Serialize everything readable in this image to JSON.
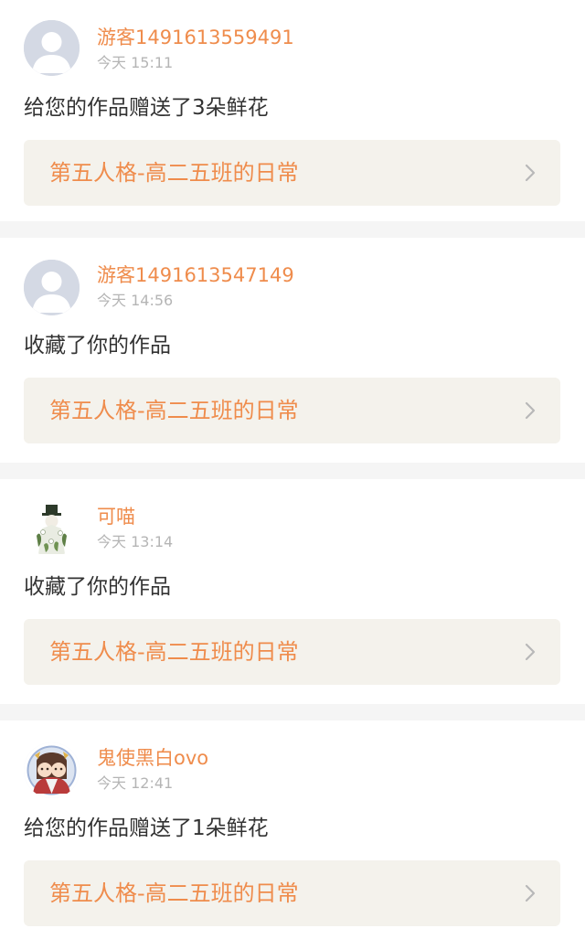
{
  "colors": {
    "accent": "#ef8c4c",
    "time": "#b5b5b5",
    "text": "#333333",
    "card_link_bg": "#f4f2ec",
    "divider": "#f5f5f5"
  },
  "notifications": [
    {
      "avatar": "default-avatar-icon",
      "username": "游客1491613559491",
      "time": "今天 15:11",
      "message": "给您的作品赠送了3朵鲜花",
      "work_title": "第五人格-高二五班的日常"
    },
    {
      "avatar": "default-avatar-icon",
      "username": "游客1491613547149",
      "time": "今天 14:56",
      "message": "收藏了你的作品",
      "work_title": "第五人格-高二五班的日常"
    },
    {
      "avatar": "character-avatar-icon",
      "username": "可喵",
      "time": "今天 13:14",
      "message": "收藏了你的作品",
      "work_title": "第五人格-高二五班的日常"
    },
    {
      "avatar": "character-avatar-icon",
      "username": "鬼使黑白ovo",
      "time": "今天 12:41",
      "message": "给您的作品赠送了1朵鲜花",
      "work_title": "第五人格-高二五班的日常"
    }
  ]
}
